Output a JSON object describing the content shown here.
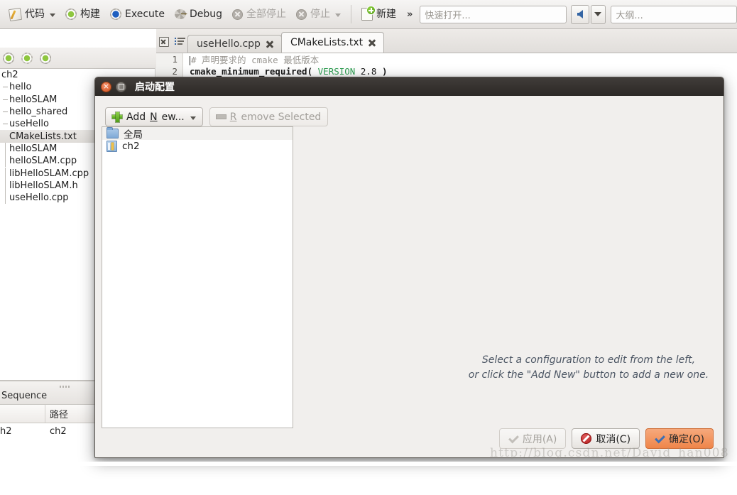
{
  "toolbar": {
    "items": [
      {
        "label": "代码",
        "icon": "note-pencil-icon",
        "caret": true,
        "disabled": false
      },
      {
        "label": "构建",
        "icon": "gear-green-icon",
        "caret": false,
        "disabled": false
      },
      {
        "label": "Execute",
        "icon": "gear-blue-icon",
        "caret": false,
        "disabled": false
      },
      {
        "label": "Debug",
        "icon": "bug-icon",
        "caret": false,
        "disabled": false
      },
      {
        "label": "全部停止",
        "icon": "stop-all-icon",
        "caret": false,
        "disabled": true
      },
      {
        "label": "停止",
        "icon": "stop-icon",
        "caret": true,
        "disabled": true
      },
      {
        "label": "新建",
        "icon": "new-file-icon",
        "caret": false,
        "disabled": false
      }
    ],
    "overflow_label": "»",
    "quick_open_placeholder": "快速打开...",
    "outline_placeholder": "大纲...",
    "back_icon": "arrow-left-icon",
    "back_dropdown_icon": "triangle-down-icon"
  },
  "project_toolbar": {
    "icons": [
      "gear-green-icon",
      "gear-build-down-icon",
      "gear-clean-icon"
    ]
  },
  "tree": {
    "items": [
      {
        "label": "ch2",
        "indent": 0,
        "guide": "none",
        "selected": false
      },
      {
        "label": "hello",
        "indent": 1,
        "guide": "dash",
        "selected": false
      },
      {
        "label": "helloSLAM",
        "indent": 1,
        "guide": "dash",
        "selected": false
      },
      {
        "label": "hello_shared",
        "indent": 1,
        "guide": "dash",
        "selected": false
      },
      {
        "label": "useHello",
        "indent": 1,
        "guide": "dash",
        "selected": false
      },
      {
        "label": "CMakeLists.txt",
        "indent": 1,
        "guide": "none",
        "selected": true
      },
      {
        "label": "helloSLAM",
        "indent": 1,
        "guide": "line",
        "selected": false
      },
      {
        "label": "helloSLAM.cpp",
        "indent": 1,
        "guide": "line",
        "selected": false
      },
      {
        "label": "libHelloSLAM.cpp",
        "indent": 1,
        "guide": "line",
        "selected": false
      },
      {
        "label": "libHelloSLAM.h",
        "indent": 1,
        "guide": "line",
        "selected": false
      },
      {
        "label": "useHello.cpp",
        "indent": 1,
        "guide": "line",
        "selected": false
      }
    ]
  },
  "sequence_panel": {
    "title": "Sequence",
    "columns": [
      "",
      "路径"
    ],
    "rows": [
      {
        "name": "h2",
        "path": "ch2"
      }
    ]
  },
  "tabstrip": {
    "close_icon": "close-box-icon",
    "list_icon": "document-list-icon",
    "tabs": [
      {
        "label": "useHello.cpp",
        "active": false,
        "close_icon": "close-icon"
      },
      {
        "label": "CMakeLists.txt",
        "active": true,
        "close_icon": "close-icon"
      }
    ]
  },
  "code": {
    "lines": [
      {
        "number": "1",
        "comment": "# 声明要求的 cmake 最低版本"
      },
      {
        "number": "2",
        "fn": "cmake_minimum_required",
        "open": "(",
        "kw": "VERSION",
        "num": "2.8",
        "close": ")"
      }
    ]
  },
  "dialog": {
    "title": "启动配置",
    "close_icon": "window-close-icon",
    "maximize_icon": "window-maximize-icon",
    "toolbar": {
      "add_new_label_pre": "Add ",
      "add_new_label_key": "N",
      "add_new_label_post": "ew...",
      "add_new_icon": "plus-icon",
      "add_new_caret_icon": "triangle-down-icon",
      "remove_label_pre": "",
      "remove_label_key": "R",
      "remove_label_post": "emove Selected",
      "remove_icon": "minus-icon",
      "remove_disabled": true
    },
    "configurations": [
      {
        "label": "全局",
        "icon": "folder-icon"
      },
      {
        "label": "ch2",
        "icon": "document-icon"
      }
    ],
    "hint_line1": "Select a configuration to edit from the left,",
    "hint_line2": "or click the \"Add New\" button to add a new one.",
    "actions": [
      {
        "label": "应用(A)",
        "icon": "check-icon",
        "state": "disabled"
      },
      {
        "label": "取消(C)",
        "icon": "deny-icon",
        "state": "normal"
      },
      {
        "label": "确定(O)",
        "icon": "check-icon",
        "state": "primary"
      }
    ]
  },
  "watermark": "http://blog.csdn.net/David_han008"
}
